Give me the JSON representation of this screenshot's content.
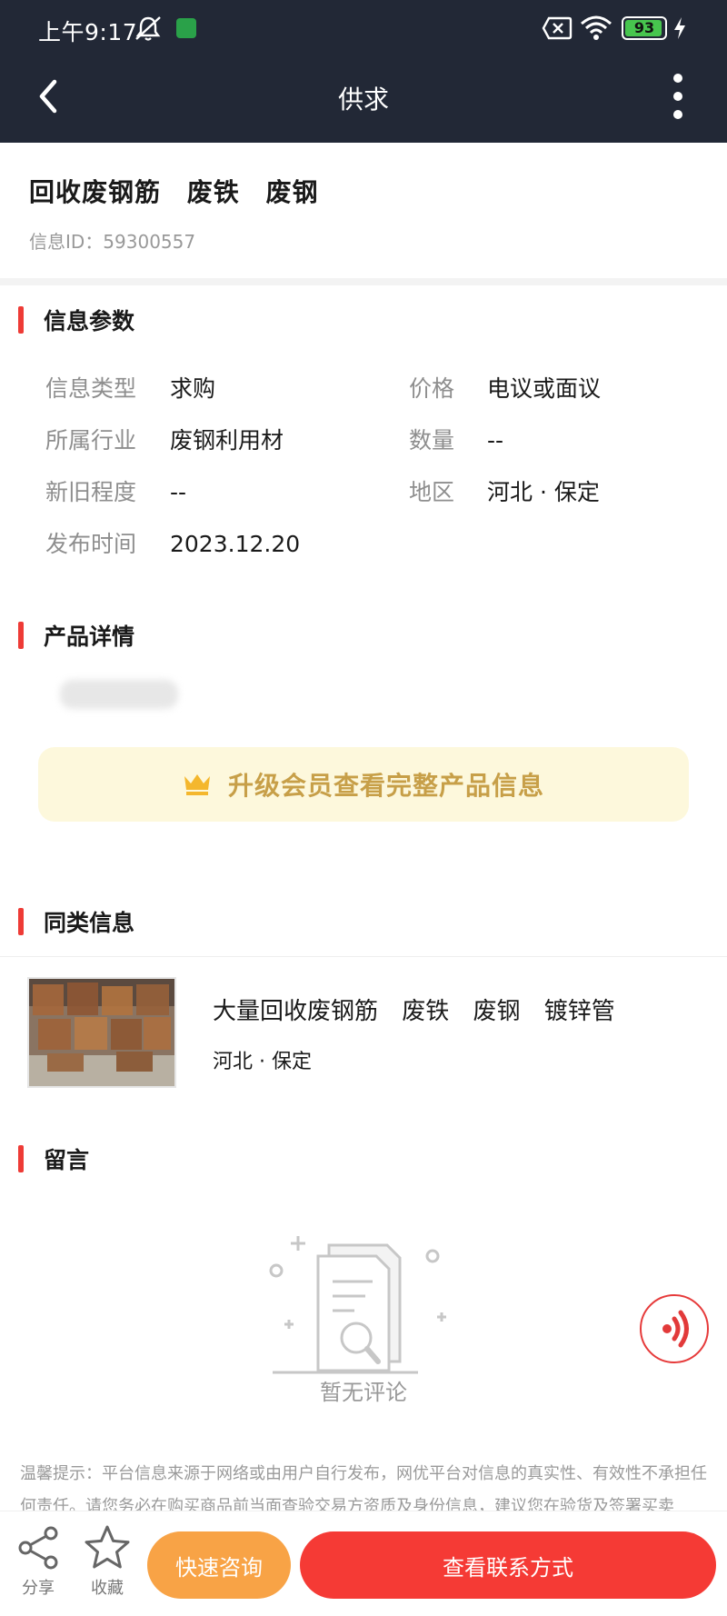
{
  "status_bar": {
    "time": "上午9:17",
    "battery": "93",
    "icons": [
      "mute-icon",
      "app-notification-icon",
      "sim-off-icon",
      "wifi-icon",
      "battery-icon",
      "charging-icon"
    ]
  },
  "navbar": {
    "back_icon": "chevron-left-icon",
    "title": "供求",
    "more_icon": "more-vertical-icon"
  },
  "headline": {
    "title": "回收废钢筋 废铁 废钢",
    "info_id": "信息ID：59300557"
  },
  "sections": {
    "params": "信息参数",
    "detail": "产品详情",
    "similar": "同类信息",
    "comments": "留言"
  },
  "params": {
    "rows": [
      [
        {
          "key": "信息类型",
          "value": "求购"
        },
        {
          "key": "价格",
          "value": "电议或面议"
        }
      ],
      [
        {
          "key": "所属行业",
          "value": "废钢利用材"
        },
        {
          "key": "数量",
          "value": "--"
        }
      ],
      [
        {
          "key": "新旧程度",
          "value": "--"
        },
        {
          "key": "地区",
          "value": "河北 · 保定"
        }
      ],
      [
        {
          "key": "发布时间",
          "value": "2023.12.20"
        }
      ]
    ]
  },
  "detail": {
    "upgrade_text": "升级会员查看完整产品信息",
    "upgrade_icon": "crown-icon"
  },
  "similar": {
    "title": "大量回收废钢筋 废铁 废钢 镀锌管",
    "region": "河北 · 保定"
  },
  "comments": {
    "empty_text": "暂无评论"
  },
  "tips": "温馨提示：平台信息来源于网络或由用户自行发布，网优平台对信息的真实性、有效性不承担任何责任。请您务必在购买商品前当面查验交易方资质及身份信息，建议您在验货及签署买卖",
  "bottom_bar": {
    "share_label": "分享",
    "favorite_label": "收藏",
    "consult_label": "快速咨询",
    "contact_label": "查看联系方式"
  },
  "colors": {
    "header_bg": "#222836",
    "accent_red": "#f53a35",
    "accent_orange": "#f8a346",
    "upgrade_bg": "#fdf8dc",
    "upgrade_text": "#c79f48"
  }
}
